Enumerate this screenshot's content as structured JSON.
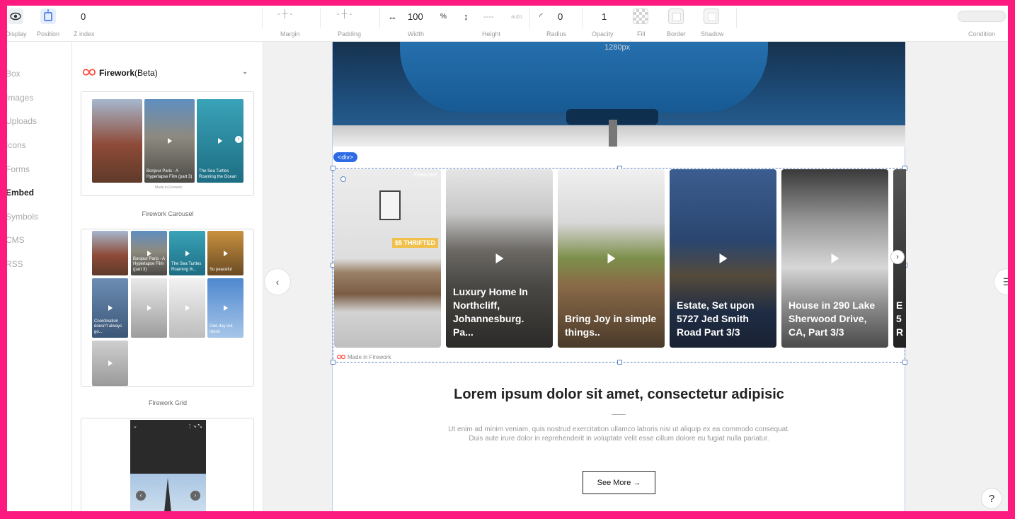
{
  "toolbar": {
    "display_label": "Display",
    "position_label": "Position",
    "zindex_value": "0",
    "zindex_label": "Z index",
    "margin_label": "Margin",
    "padding_label": "Padding",
    "width_value": "100",
    "width_unit": "%",
    "width_label": "Width",
    "height_value": "----",
    "height_unit": "auto",
    "height_label": "Height",
    "radius_value": "0",
    "radius_label": "Radius",
    "opacity_value": "1",
    "opacity_label": "Opacity",
    "fill_label": "Fill",
    "border_label": "Border",
    "shadow_label": "Shadow",
    "condition_label": "Condition"
  },
  "leftnav": {
    "items": [
      {
        "label": "Box"
      },
      {
        "label": "Images"
      },
      {
        "label": "Uploads"
      },
      {
        "label": "Icons"
      },
      {
        "label": "Forms"
      },
      {
        "label": "Embed"
      },
      {
        "label": "Symbols"
      },
      {
        "label": "CMS"
      },
      {
        "label": "RSS"
      }
    ],
    "active": "Embed"
  },
  "panel": {
    "title": "Firework",
    "title_suffix": "(Beta)",
    "carousel": {
      "caption": "Firework Carousel",
      "made_in": "Made in Firework",
      "thumbs": [
        {
          "text": ""
        },
        {
          "text": "Bonjour Paris - A Hyperlapse Film (part 3)"
        },
        {
          "text": "The Sea Turtles Roaming the Ocean"
        }
      ]
    },
    "grid": {
      "caption": "Firework Grid",
      "thumbs": [
        {
          "text": ""
        },
        {
          "text": "Bonjour Paris - A Hyperlapse Film (part 3)"
        },
        {
          "text": "The Sea Turtles Roaming th..."
        },
        {
          "text": "So peaceful"
        },
        {
          "text": "Coordination doesn't always go..."
        },
        {
          "text": ""
        },
        {
          "text": ""
        },
        {
          "text": "One day out there!"
        },
        {
          "text": ""
        }
      ]
    }
  },
  "canvas": {
    "page_width_label": "1280px",
    "div_tag": "<div>",
    "featured_label": "Featured",
    "thrifted_label": "$5 THRIFTED",
    "made_in": "Made in Firework",
    "videos": [
      {
        "caption": ""
      },
      {
        "caption": "Luxury Home In Northcliff, Johannesburg. Pa..."
      },
      {
        "caption": "Bring Joy in simple things.."
      },
      {
        "caption": "Estate, Set upon 5727 Jed Smith Road Part 3/3"
      },
      {
        "caption": "House in 290 Lake Sherwood Drive, CA, Part 3/3"
      },
      {
        "caption": "E 5 R"
      }
    ],
    "headline": "Lorem ipsum dolor sit amet, consectetur adipisic",
    "body": "Ut enim ad minim veniam, quis nostrud exercitation ullamco laboris nisi ut aliquip ex ea commodo consequat. Duis aute irure dolor in reprehenderit in voluptate velit esse cillum dolore eu fugiat nulla pariatur.",
    "cta": "See More →",
    "help": "?"
  }
}
